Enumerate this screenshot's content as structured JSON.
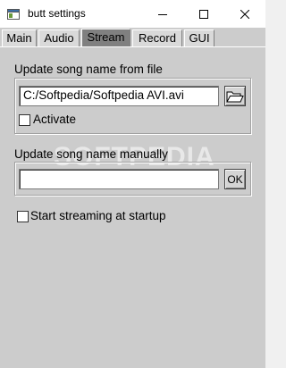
{
  "window": {
    "title": "butt settings",
    "icons": {
      "app": "app-window-icon",
      "minimize": "minimize-icon",
      "maximize": "maximize-icon",
      "close": "close-icon"
    }
  },
  "tabs": [
    {
      "label": "Main",
      "active": false
    },
    {
      "label": "Audio",
      "active": false
    },
    {
      "label": "Stream",
      "active": true
    },
    {
      "label": "Record",
      "active": false
    },
    {
      "label": "GUI",
      "active": false
    }
  ],
  "stream": {
    "file_group": {
      "label": "Update song name from file",
      "file_path": "C:/Softpedia/Softpedia AVI.avi",
      "browse_icon": "folder-open-icon",
      "activate_label": "Activate",
      "activate_checked": false
    },
    "manual_group": {
      "label": "Update song name manually",
      "song_name": "",
      "ok_label": "OK"
    },
    "start_streaming_label": "Start streaming at startup",
    "start_streaming_checked": false
  },
  "watermark": "SOFTPEDIA",
  "colors": {
    "window_bg": "#cccccc",
    "active_tab": "#808080",
    "field_bg": "#ffffff"
  }
}
